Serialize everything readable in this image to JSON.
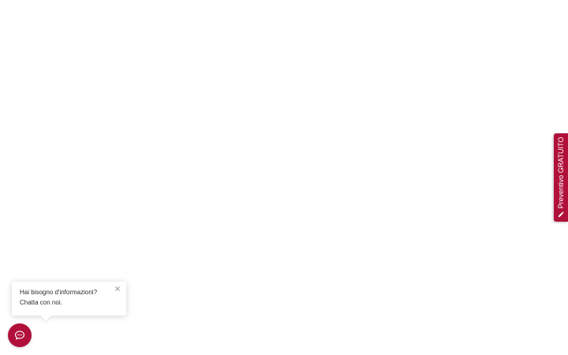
{
  "quote_tab": {
    "label": "Preventivo GRATUITO",
    "icon": "pencil-icon"
  },
  "chat_bubble": {
    "message": "Hai bisogno d'informazioni? Chatta con noi.",
    "close_icon": "close-icon"
  },
  "chat_launcher": {
    "icon": "chat-icon"
  },
  "colors": {
    "accent": "#b0103a",
    "background": "#ffffff",
    "text": "#2b2b2b"
  }
}
